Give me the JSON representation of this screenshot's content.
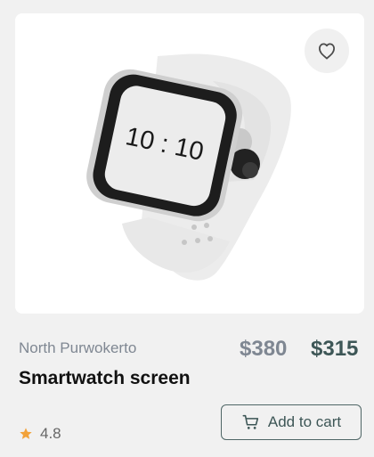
{
  "product": {
    "location": "North Purwokerto",
    "title": "Smartwatch screen",
    "old_price": "$380",
    "new_price": "$315",
    "rating": "4.8",
    "watch_time": "10 : 10",
    "add_to_cart_label": "Add to cart"
  },
  "colors": {
    "accent": "#3d5656",
    "muted": "#7f8792",
    "star": "#f2a23a"
  },
  "icons": {
    "favorite": "heart-icon",
    "cart": "cart-icon",
    "rating": "star-icon"
  }
}
